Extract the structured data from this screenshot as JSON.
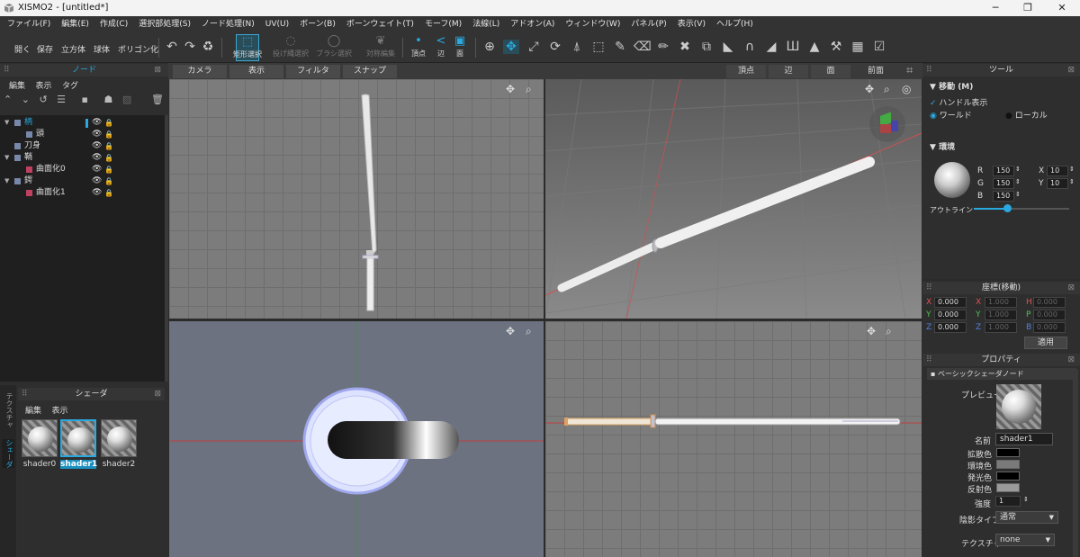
{
  "window": {
    "title": "XISMO2 - [untitled*]",
    "minimize": "─",
    "maximize": "❐",
    "close": "✕"
  },
  "menu": [
    "ファイル(F)",
    "編集(E)",
    "作成(C)",
    "選択部処理(S)",
    "ノード処理(N)",
    "UV(U)",
    "ボーン(B)",
    "ボーンウェイト(T)",
    "モーフ(M)",
    "法線(L)",
    "アドオン(A)",
    "ウィンドウ(W)",
    "パネル(P)",
    "表示(V)",
    "ヘルプ(H)"
  ],
  "toolbar": {
    "open": "開く",
    "save": "保存",
    "cube": "立方体",
    "sphere": "球体",
    "polygon": "ポリゴン化",
    "rect_select": "矩形選択",
    "lasso_select": "投げ縄選択",
    "brush_select": "ブラシ選択",
    "sym_edit": "対称編集",
    "vertex": "頂点",
    "edge": "辺",
    "face": "面"
  },
  "node_panel": {
    "header": "ノード",
    "menu": [
      "編集",
      "表示",
      "タグ"
    ],
    "tree": [
      {
        "label": "柄",
        "depth": 0,
        "expanded": true,
        "type": "node",
        "selected": true
      },
      {
        "label": "頭",
        "depth": 1,
        "expanded": false,
        "type": "node"
      },
      {
        "label": "刀身",
        "depth": 0,
        "expanded": false,
        "type": "node"
      },
      {
        "label": "鞘",
        "depth": 0,
        "expanded": true,
        "type": "node"
      },
      {
        "label": "曲面化0",
        "depth": 1,
        "expanded": false,
        "type": "mesh"
      },
      {
        "label": "鍔",
        "depth": 0,
        "expanded": true,
        "type": "node"
      },
      {
        "label": "曲面化1",
        "depth": 1,
        "expanded": false,
        "type": "mesh"
      }
    ]
  },
  "shader_panel": {
    "header": "シェーダ",
    "menu": [
      "編集",
      "表示"
    ],
    "vtabs": [
      "テクスチャ",
      "シェーダ"
    ],
    "shaders": [
      "shader0",
      "shader1",
      "shader2"
    ],
    "selected": "shader1"
  },
  "viewport_bar": {
    "dropdowns": [
      "カメラ",
      "表示",
      "フィルタ",
      "スナップ"
    ],
    "modes": [
      "頂点",
      "辺",
      "面"
    ],
    "view": "前面"
  },
  "tool_panel": {
    "header": "ツール",
    "section_move": "移動 (M)",
    "handle_display": "ハンドル表示",
    "world": "ワールド",
    "local": "ローカル",
    "section_env": "環境",
    "r_label": "R",
    "g_label": "G",
    "b_label": "B",
    "r": "150",
    "g": "150",
    "b": "150",
    "x_label": "X",
    "y_label": "Y",
    "x": "10",
    "y": "10",
    "outline": "アウトライン",
    "outline_level": 0.35
  },
  "coord_panel": {
    "header": "座標(移動)",
    "rows": [
      {
        "a": "X",
        "av": "0.000",
        "b": "X",
        "bv": "1.000",
        "c": "H",
        "cv": "0.000"
      },
      {
        "a": "Y",
        "av": "0.000",
        "b": "Y",
        "bv": "1.000",
        "c": "P",
        "cv": "0.000"
      },
      {
        "a": "Z",
        "av": "0.000",
        "b": "Z",
        "bv": "1.000",
        "c": "B",
        "cv": "0.000"
      }
    ],
    "apply": "適用"
  },
  "property_panel": {
    "header": "プロパティ",
    "node_type": "ベーシックシェーダノード",
    "preview": "プレビュー",
    "name_label": "名前",
    "name": "shader1",
    "diffuse": "拡散色",
    "ambient": "環境色",
    "emissive": "発光色",
    "specular": "反射色",
    "intensity_label": "強度",
    "intensity": "1",
    "shade_type_label": "陰影タイプ",
    "shade_type": "通常",
    "texture_label": "テクスチャ",
    "texture": "none",
    "colors": {
      "diffuse": "#000000",
      "ambient": "#7a7a7a",
      "emissive": "#000000",
      "specular": "#9a9a9a"
    }
  },
  "colors": {
    "accent": "#29a9e0",
    "selected_row": "#1a8fc0"
  }
}
